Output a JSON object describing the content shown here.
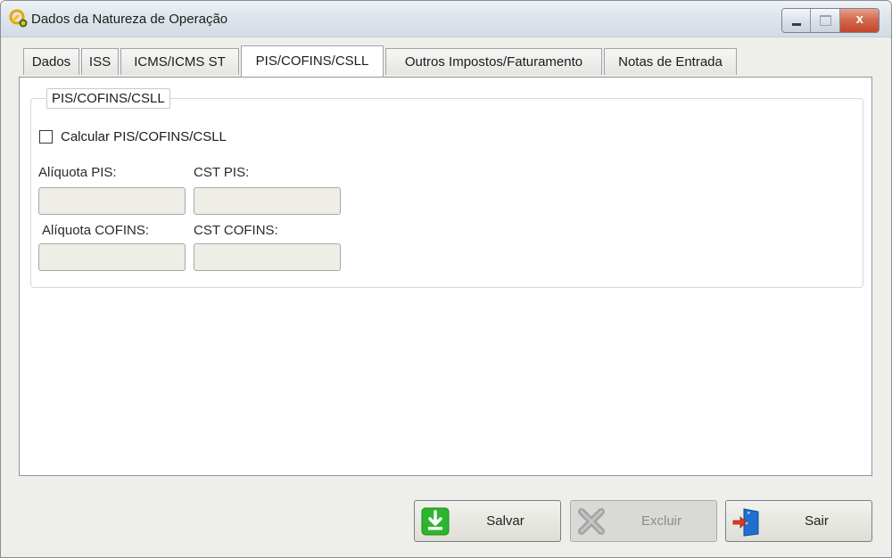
{
  "window": {
    "title": "Dados da Natureza de Operação",
    "close_glyph": "x"
  },
  "tabs": [
    {
      "label": "Dados",
      "active": false
    },
    {
      "label": "ISS",
      "active": false
    },
    {
      "label": "ICMS/ICMS ST",
      "active": false
    },
    {
      "label": "PIS/COFINS/CSLL",
      "active": true
    },
    {
      "label": "Outros Impostos/Faturamento",
      "active": false
    },
    {
      "label": "Notas de Entrada",
      "active": false
    }
  ],
  "group": {
    "legend": "PIS/COFINS/CSLL",
    "calcular_label": "Calcular PIS/COFINS/CSLL",
    "calcular_checked": false,
    "aliquota_pis_label": "Alíquota PIS:",
    "aliquota_pis_value": "",
    "cst_pis_label": "CST PIS:",
    "cst_pis_value": "",
    "aliquota_cofins_label": "Alíquota COFINS:",
    "aliquota_cofins_value": "",
    "cst_cofins_label": "CST COFINS:",
    "cst_cofins_value": ""
  },
  "buttons": {
    "salvar": "Salvar",
    "excluir": "Excluir",
    "sair": "Sair"
  },
  "colors": {
    "salvar_icon": "#2db52d",
    "excluir_icon": "#a4a4a4",
    "sair_icon_door": "#1f6fd0",
    "sair_icon_arrow": "#e03a24"
  }
}
